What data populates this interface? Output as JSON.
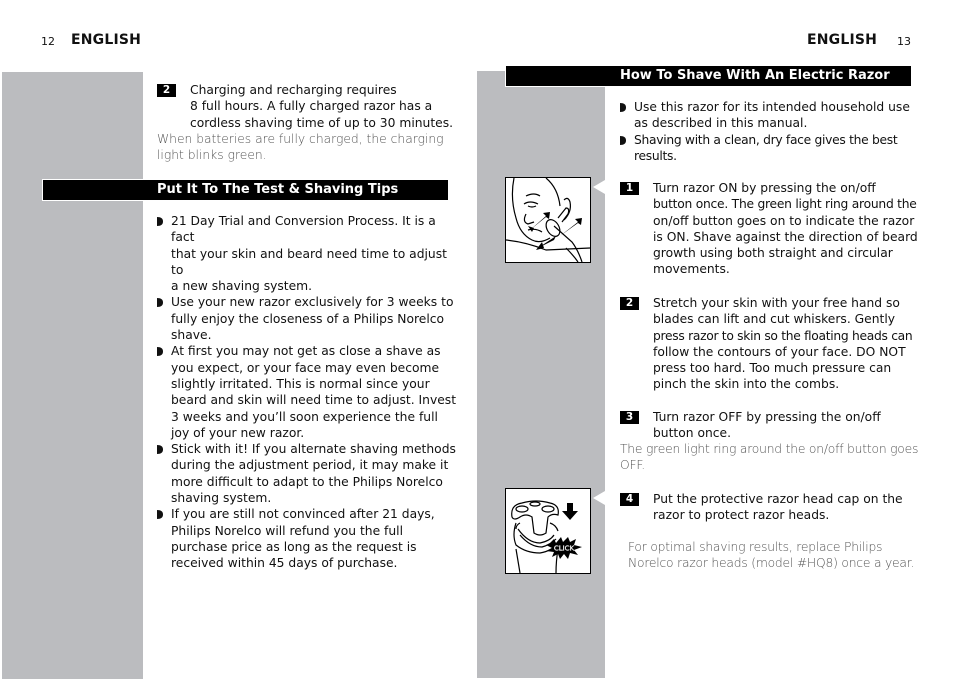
{
  "left_page": {
    "page_number": "12",
    "running_head": "ENGLISH",
    "charging_step": {
      "number": "2",
      "lines": [
        "Charging and recharging requires",
        "8 full hours.  A fully charged razor has a",
        "cordless shaving time of up to 30 minutes."
      ],
      "note_lines": [
        "When batteries are fully charged, the charging",
        "light blinks green."
      ]
    },
    "section_title": "Put It To The Test & Shaving Tips",
    "tips": [
      {
        "lines": [
          "21 Day Trial and Conversion Process. It is a fact",
          "that your skin and beard need time to adjust to",
          "a new shaving system."
        ]
      },
      {
        "lines": [
          "Use your new razor exclusively for 3 weeks to",
          "fully enjoy the closeness of a Philips Norelco",
          "shave."
        ]
      },
      {
        "lines": [
          "At first you may not get as close a shave as",
          "you expect, or your face may even become",
          "slightly irritated. This is normal since your",
          "beard and skin will need time to adjust. Invest",
          "3 weeks and you’ll soon experience the full",
          "joy of your new razor."
        ]
      },
      {
        "lines": [
          "Stick with it! If you alternate shaving methods",
          "during the adjustment period, it may make it",
          "more difficult to adapt to the Philips Norelco",
          "shaving system."
        ]
      },
      {
        "lines": [
          "If you are still not convinced after 21 days,",
          "Philips Norelco will refund you the full",
          "purchase price as long as the request is",
          "received within 45 days of purchase."
        ]
      }
    ]
  },
  "right_page": {
    "page_number": "13",
    "running_head": "ENGLISH",
    "section_title": "How To Shave With An Electric Razor",
    "intro_bullets": [
      {
        "lines": [
          "Use this razor for its intended household use",
          "as described in this manual."
        ]
      },
      {
        "lines": [
          "Shaving with a clean, dry face gives the best",
          "results."
        ]
      }
    ],
    "steps": [
      {
        "number": "1",
        "lines": [
          "Turn razor ON by pressing the on/off",
          "button once. The green light ring around the",
          "on/off button goes on to indicate the razor",
          "is ON. Shave against the direction of beard",
          "growth using both straight and circular",
          "movements."
        ]
      },
      {
        "number": "2",
        "lines": [
          "Stretch your skin with your free hand so",
          "blades can lift and cut whiskers. Gently",
          "press razor to skin so the floating heads can",
          "follow the contours of your face. DO NOT",
          "press too hard. Too much pressure can",
          "pinch the skin into the combs."
        ]
      },
      {
        "number": "3",
        "lines": [
          "Turn razor OFF by pressing the on/off",
          "button once."
        ],
        "note_lines": [
          "The green light ring around the on/off button goes",
          "OFF."
        ]
      },
      {
        "number": "4",
        "lines": [
          "Put the protective razor head cap on the",
          "razor to protect razor heads."
        ]
      }
    ],
    "replacement_note": [
      "For optimal shaving results, replace Philips",
      "Norelco razor heads (model #HQ8) once a year."
    ],
    "illustrations": {
      "shaving_face": "man shaving face with circular arrows",
      "cap_click_label": "CLICK"
    }
  }
}
